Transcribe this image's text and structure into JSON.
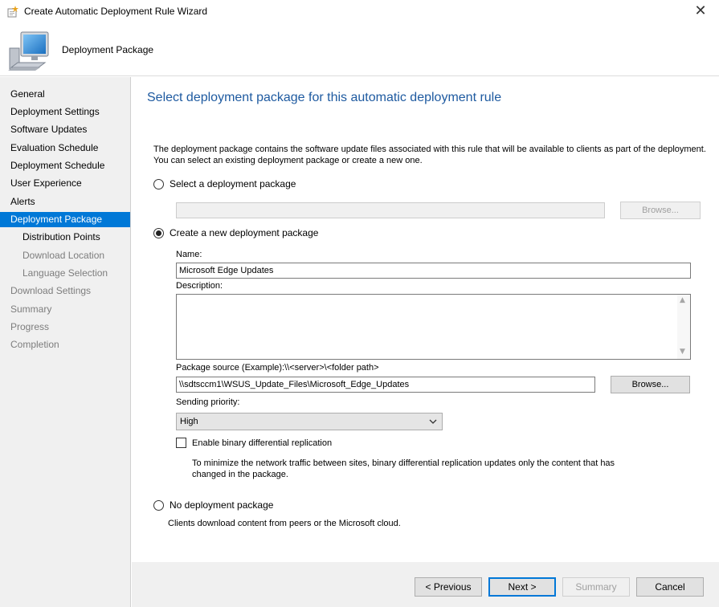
{
  "window": {
    "title": "Create Automatic Deployment Rule Wizard",
    "close_glyph": "✕"
  },
  "header": {
    "page_name": "Deployment Package",
    "icon": "computer-icon"
  },
  "sidebar": {
    "items": [
      {
        "label": "General",
        "state": "normal"
      },
      {
        "label": "Deployment Settings",
        "state": "normal"
      },
      {
        "label": "Software Updates",
        "state": "normal"
      },
      {
        "label": "Evaluation Schedule",
        "state": "normal"
      },
      {
        "label": "Deployment Schedule",
        "state": "normal"
      },
      {
        "label": "User Experience",
        "state": "normal"
      },
      {
        "label": "Alerts",
        "state": "normal"
      },
      {
        "label": "Deployment Package",
        "state": "active"
      },
      {
        "label": "Distribution Points",
        "state": "sub"
      },
      {
        "label": "Download Location",
        "state": "sub-disabled"
      },
      {
        "label": "Language Selection",
        "state": "sub-disabled"
      },
      {
        "label": "Download Settings",
        "state": "disabled"
      },
      {
        "label": "Summary",
        "state": "disabled"
      },
      {
        "label": "Progress",
        "state": "disabled"
      },
      {
        "label": "Completion",
        "state": "disabled"
      }
    ]
  },
  "main": {
    "heading": "Select deployment package for this automatic deployment rule",
    "intro_line1": "The deployment package contains the software update files associated with this rule that will be available to clients as part of the deployment.",
    "intro_line2": "You can select an existing deployment package or create a new one.",
    "option_existing": {
      "label": "Select a deployment package",
      "checked": false,
      "value": "",
      "browse_label": "Browse..."
    },
    "option_new": {
      "label": "Create a new deployment package",
      "checked": true,
      "name_label": "Name:",
      "name_value": "Microsoft Edge Updates",
      "description_label": "Description:",
      "description_value": "",
      "source_label": "Package source (Example):\\\\<server>\\<folder path>",
      "source_value": "\\\\sdtsccm1\\WSUS_Update_Files\\Microsoft_Edge_Updates",
      "browse_label": "Browse...",
      "priority_label": "Sending priority:",
      "priority_value": "High",
      "bdr_label": "Enable binary differential replication",
      "bdr_checked": false,
      "bdr_help_line1": "To minimize the network traffic between sites, binary differential replication updates only the content that has",
      "bdr_help_line2": "changed in the package."
    },
    "option_none": {
      "label": "No deployment package",
      "checked": false,
      "help": "Clients download content from peers or the Microsoft cloud."
    }
  },
  "footer": {
    "previous": "< Previous",
    "next": "Next >",
    "summary": "Summary",
    "cancel": "Cancel"
  }
}
